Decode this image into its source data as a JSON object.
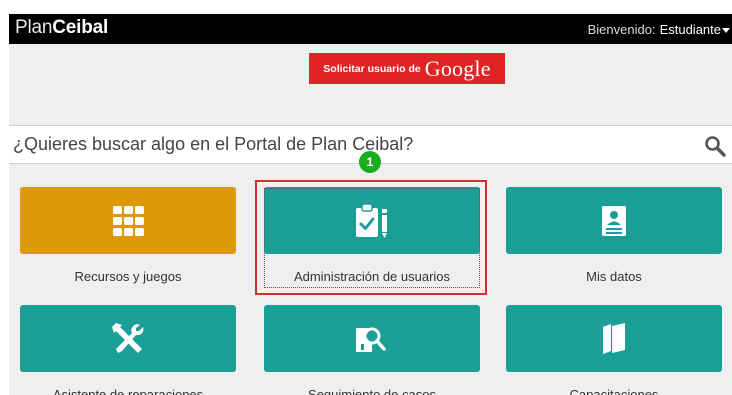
{
  "header": {
    "logo_part1": "Plan",
    "logo_part2": "Ceibal",
    "welcome_text": "Bienvenido:",
    "user_name": "Estudiante"
  },
  "google_button": {
    "prefix": "Solicitar usuario de",
    "brand": "Google"
  },
  "search": {
    "placeholder": "¿Quieres buscar algo en el Portal de Plan Ceibal?",
    "icon": "search-icon"
  },
  "step_badge": "1",
  "tiles": [
    {
      "label": "Recursos y juegos",
      "icon": "grid-icon",
      "color": "#dc9a0a"
    },
    {
      "label": "Administración de usuarios",
      "icon": "clipboard-check-icon",
      "color": "#1a9e96"
    },
    {
      "label": "Mis datos",
      "icon": "id-card-icon",
      "color": "#1a9e96"
    },
    {
      "label": "Asistente de reparaciones",
      "icon": "tools-icon",
      "color": "#1a9e96"
    },
    {
      "label": "Seguimiento de casos",
      "icon": "document-search-icon",
      "color": "#1a9e96"
    },
    {
      "label": "Capacitaciones",
      "icon": "books-icon",
      "color": "#1a9e96"
    }
  ],
  "colors": {
    "teal": "#1a9e96",
    "amber": "#dc9a0a",
    "google_red": "#e02424",
    "highlight_red": "#d32d2d",
    "badge_green": "#1aac1a"
  }
}
